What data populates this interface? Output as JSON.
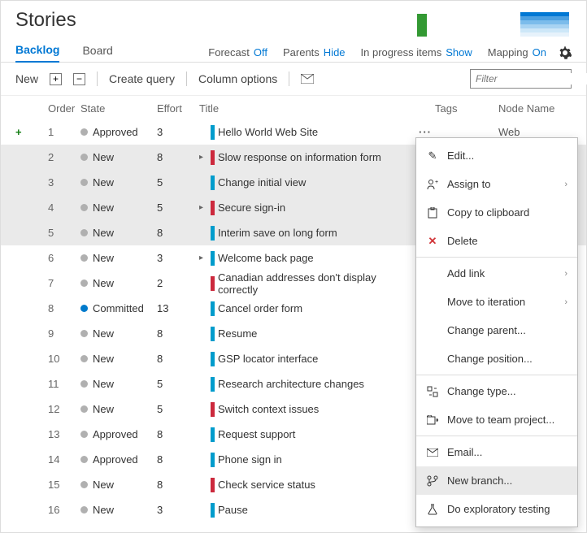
{
  "header": {
    "title": "Stories"
  },
  "tabs": {
    "backlog": "Backlog",
    "board": "Board"
  },
  "viewOptions": {
    "forecast_label": "Forecast",
    "forecast_val": "Off",
    "parents_label": "Parents",
    "parents_val": "Hide",
    "progress_label": "In progress items",
    "progress_val": "Show",
    "mapping_label": "Mapping",
    "mapping_val": "On"
  },
  "toolbar": {
    "new": "New",
    "create_query": "Create query",
    "column_options": "Column options"
  },
  "filter": {
    "placeholder": "Filter"
  },
  "columns": {
    "order": "Order",
    "state": "State",
    "effort": "Effort",
    "title": "Title",
    "tags": "Tags",
    "node": "Node Name"
  },
  "rows": [
    {
      "order": "1",
      "state": "Approved",
      "dot": "gray",
      "effort": "3",
      "chev": false,
      "bar": "blue",
      "title": "Hello World Web Site",
      "node": "Web",
      "first": true,
      "ellip": true
    },
    {
      "order": "2",
      "state": "New",
      "dot": "gray",
      "effort": "8",
      "chev": true,
      "bar": "red",
      "title": "Slow response on information form",
      "sel": true
    },
    {
      "order": "3",
      "state": "New",
      "dot": "gray",
      "effort": "5",
      "chev": false,
      "bar": "blue",
      "title": "Change initial view",
      "sel": true
    },
    {
      "order": "4",
      "state": "New",
      "dot": "gray",
      "effort": "5",
      "chev": true,
      "bar": "red",
      "title": "Secure sign-in",
      "sel": true
    },
    {
      "order": "5",
      "state": "New",
      "dot": "gray",
      "effort": "8",
      "chev": false,
      "bar": "blue",
      "title": "Interim save on long form",
      "sel": true
    },
    {
      "order": "6",
      "state": "New",
      "dot": "gray",
      "effort": "3",
      "chev": true,
      "bar": "blue",
      "title": "Welcome back page"
    },
    {
      "order": "7",
      "state": "New",
      "dot": "gray",
      "effort": "2",
      "chev": false,
      "bar": "red",
      "title": "Canadian addresses don't display correctly"
    },
    {
      "order": "8",
      "state": "Committed",
      "dot": "blue",
      "effort": "13",
      "chev": false,
      "bar": "blue",
      "title": "Cancel order form"
    },
    {
      "order": "9",
      "state": "New",
      "dot": "gray",
      "effort": "8",
      "chev": false,
      "bar": "blue",
      "title": "Resume"
    },
    {
      "order": "10",
      "state": "New",
      "dot": "gray",
      "effort": "8",
      "chev": false,
      "bar": "blue",
      "title": "GSP locator interface"
    },
    {
      "order": "11",
      "state": "New",
      "dot": "gray",
      "effort": "5",
      "chev": false,
      "bar": "blue",
      "title": "Research architecture changes"
    },
    {
      "order": "12",
      "state": "New",
      "dot": "gray",
      "effort": "5",
      "chev": false,
      "bar": "red",
      "title": "Switch context issues"
    },
    {
      "order": "13",
      "state": "Approved",
      "dot": "gray",
      "effort": "8",
      "chev": false,
      "bar": "blue",
      "title": "Request support"
    },
    {
      "order": "14",
      "state": "Approved",
      "dot": "gray",
      "effort": "8",
      "chev": false,
      "bar": "blue",
      "title": "Phone sign in"
    },
    {
      "order": "15",
      "state": "New",
      "dot": "gray",
      "effort": "8",
      "chev": false,
      "bar": "red",
      "title": "Check service status"
    },
    {
      "order": "16",
      "state": "New",
      "dot": "gray",
      "effort": "3",
      "chev": false,
      "bar": "blue",
      "title": "Pause"
    }
  ],
  "contextMenu": {
    "edit": "Edit...",
    "assign": "Assign to",
    "copy": "Copy to clipboard",
    "delete": "Delete",
    "addlink": "Add link",
    "moveiter": "Move to iteration",
    "chparent": "Change parent...",
    "chpos": "Change position...",
    "chtype": "Change type...",
    "moveproj": "Move to team project...",
    "email": "Email...",
    "newbranch": "New branch...",
    "exploratory": "Do exploratory testing"
  }
}
